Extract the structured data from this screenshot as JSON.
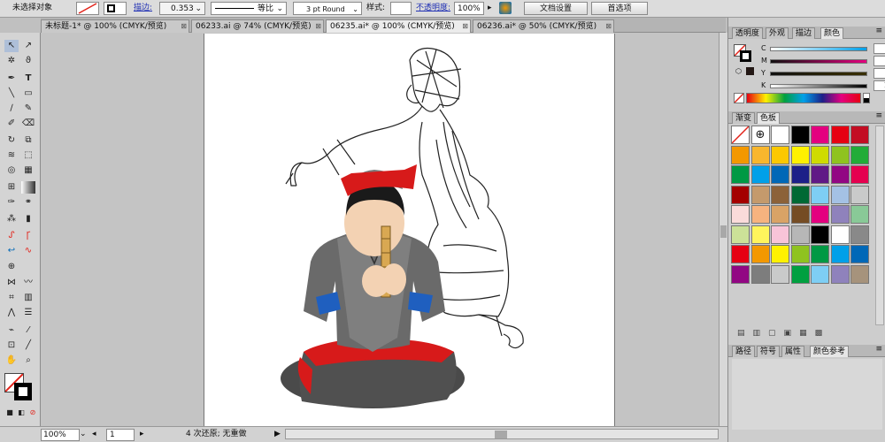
{
  "control_bar": {
    "selection": "未选择对象",
    "stroke_label": "描边:",
    "stroke_value": "0.353",
    "profile": "等比",
    "brush": "3 pt Round",
    "style_label": "样式:",
    "opacity_label": "不透明度:",
    "opacity_value": "100%",
    "doc_setup": "文档设置",
    "prefs": "首选项"
  },
  "tabs": [
    "未标题-1* @ 100% (CMYK/预览)",
    "06233.ai @ 74% (CMYK/预览)",
    "06235.ai* @ 100% (CMYK/预览)",
    "06236.ai* @ 50% (CMYK/预览)"
  ],
  "status": {
    "zoom": "100%",
    "page": "1",
    "info": "4 次还原; 无重做"
  },
  "panel": {
    "tabs_top": [
      "透明度",
      "外观",
      "描边",
      "颜色"
    ],
    "cmyk": [
      {
        "label": "C",
        "value": "0"
      },
      {
        "label": "M",
        "value": "0"
      },
      {
        "label": "Y",
        "value": "0"
      },
      {
        "label": "K",
        "value": "100"
      }
    ],
    "tabs_mid": [
      "渐变",
      "色板"
    ],
    "tabs_bot": [
      "路径",
      "符号",
      "属性",
      "颜色参考"
    ]
  },
  "colors": {
    "accent": "#e2231a",
    "canvas": "#c4c4c4"
  },
  "swatches": [
    "#ffffff",
    "#ffffff",
    "#ffffff",
    "#000000",
    "#e4007f",
    "#e60012",
    "#c30d23",
    "#f39800",
    "#f8b62d",
    "#fcc800",
    "#fff100",
    "#cfdb00",
    "#8fc31f",
    "#22ac38",
    "#009944",
    "#00a0e9",
    "#0068b7",
    "#1d2088",
    "#601986",
    "#920783",
    "#e5004f",
    "#a40000",
    "#c49a6c",
    "#8c6239",
    "#006934",
    "#7ecef4",
    "#a4c1e4",
    "#c9caca",
    "#fadbda",
    "#f6b37f",
    "#d9a366",
    "#754c24",
    "#e4007f",
    "#8f82bc",
    "#89c997",
    "#cce198",
    "#fff45c",
    "#f8c4d8",
    "#b7b7b7",
    "#000000",
    "#ffffff",
    "#898989",
    "#e60012",
    "#f39800",
    "#fff100",
    "#8fc31f",
    "#009944",
    "#00a0e9",
    "#0068b7",
    "#920783",
    "#7d7d7d",
    "#c9caca",
    "#00a040",
    "#7ecef4",
    "#8f82bc",
    "#a6937c"
  ]
}
